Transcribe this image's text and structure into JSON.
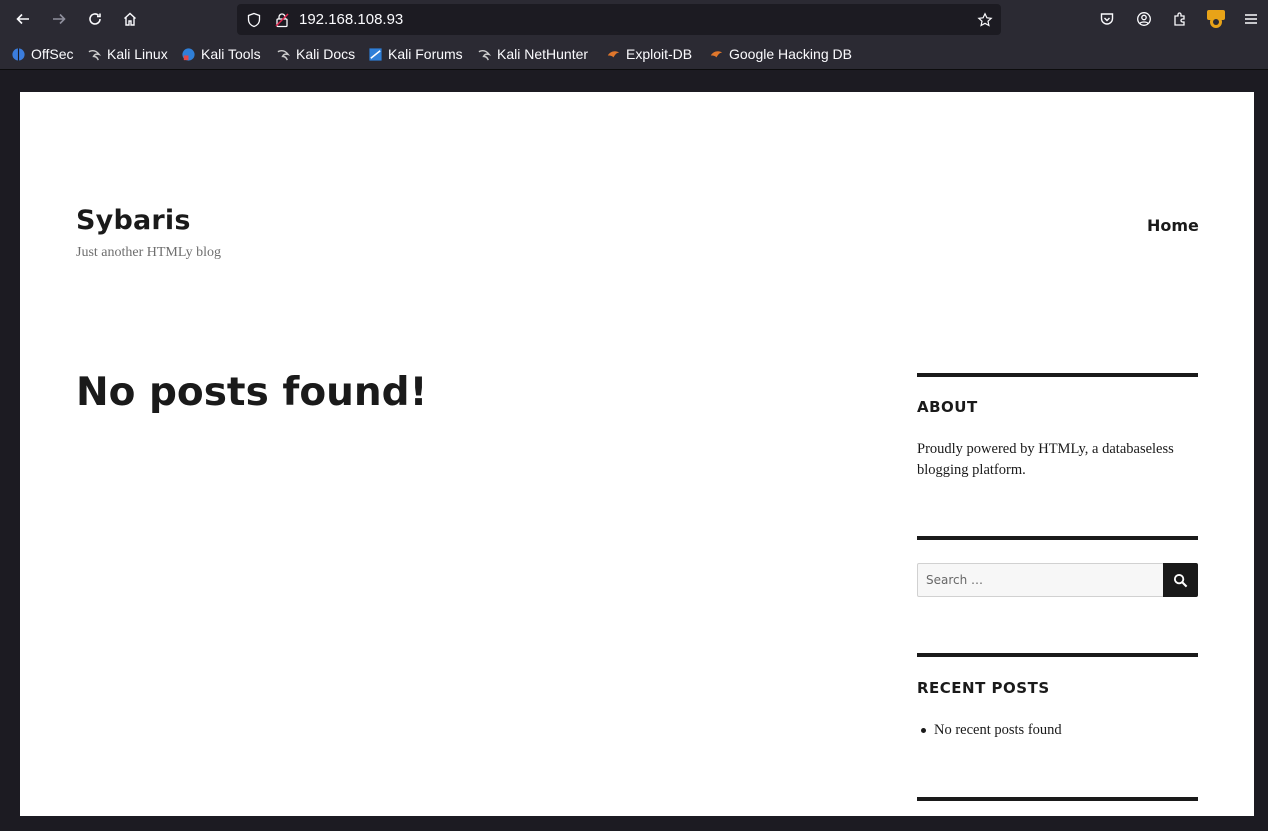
{
  "browser": {
    "url": "192.168.108.93",
    "bookmarks": [
      {
        "label": "OffSec",
        "icon": "offsec-icon",
        "color": "#3b7ddd"
      },
      {
        "label": "Kali Linux",
        "icon": "kali-dragon-icon",
        "color": "#cccccc"
      },
      {
        "label": "Kali Tools",
        "icon": "kali-tools-icon",
        "color": "#2f7fd8"
      },
      {
        "label": "Kali Docs",
        "icon": "kali-dragon-icon",
        "color": "#cccccc"
      },
      {
        "label": "Kali Forums",
        "icon": "kali-forums-icon",
        "color": "#2f7fd8"
      },
      {
        "label": "Kali NetHunter",
        "icon": "kali-dragon-icon",
        "color": "#cccccc"
      },
      {
        "label": "Exploit-DB",
        "icon": "exploit-db-icon",
        "color": "#e0772c"
      },
      {
        "label": "Google Hacking DB",
        "icon": "ghdb-icon",
        "color": "#e0772c"
      }
    ],
    "extension_badge": "burp"
  },
  "site": {
    "title": "Sybaris",
    "description": "Just another HTMLy blog",
    "nav_home": "Home"
  },
  "main": {
    "title": "No posts found!"
  },
  "sidebar": {
    "about_title": "ABOUT",
    "about_text": "Proudly powered by HTMLy, a databaseless blogging platform.",
    "search_placeholder": "Search …",
    "recent_title": "RECENT POSTS",
    "recent_items": [
      "No recent posts found"
    ]
  }
}
